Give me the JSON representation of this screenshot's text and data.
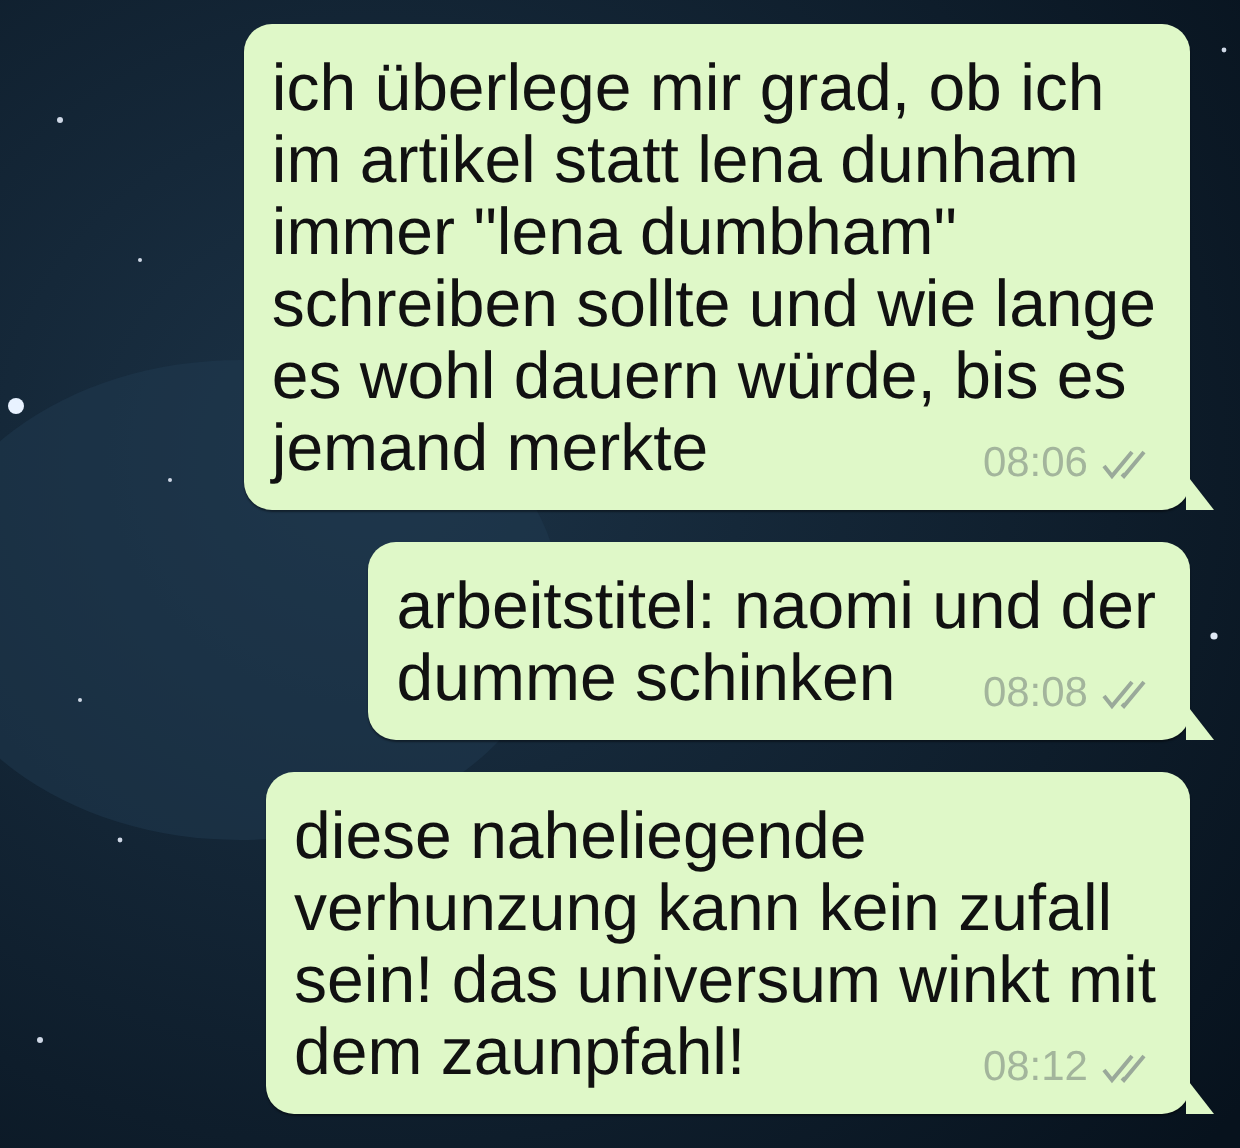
{
  "messages": [
    {
      "lines": [
        "ich überlege mir grad, ob ich",
        "im artikel statt lena dunham",
        "immer \"lena dumbham\"",
        "schreiben sollte und wie lange",
        "es wohl dauern würde, bis es",
        "jemand merkte"
      ],
      "time": "08:06",
      "read": false
    },
    {
      "lines": [
        "arbeitstitel: naomi und der",
        "dumme schinken"
      ],
      "time": "08:08",
      "read": false
    },
    {
      "lines": [
        "diese naheliegende",
        "verhunzung kann kein zufall",
        "sein! das universum winkt mit",
        "dem zaunpfahl!"
      ],
      "time": "08:12",
      "read": false
    }
  ]
}
